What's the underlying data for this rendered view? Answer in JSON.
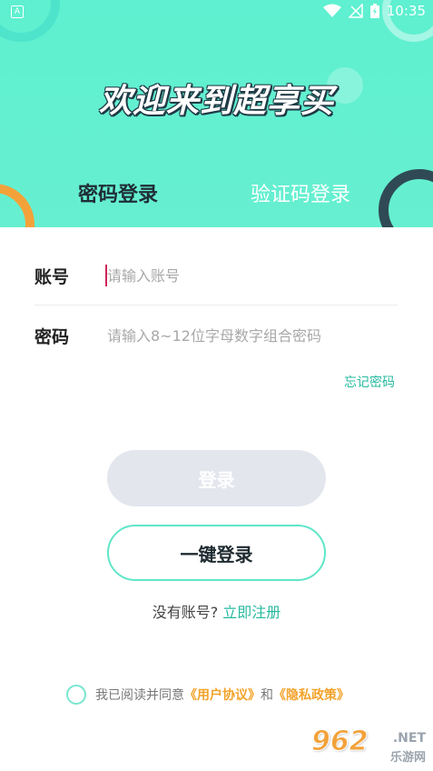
{
  "statusbar": {
    "time": "10:35",
    "left_icon": "A"
  },
  "header": {
    "title": "欢迎来到超享买",
    "tabs": [
      {
        "label": "密码登录",
        "active": true
      },
      {
        "label": "验证码登录",
        "active": false
      }
    ]
  },
  "form": {
    "account_label": "账号",
    "account_placeholder": "请输入账号",
    "password_label": "密码",
    "password_placeholder": "请输入8~12位字母数字组合密码",
    "forgot_label": "忘记密码"
  },
  "buttons": {
    "login_label": "登录",
    "quick_login_label": "一键登录"
  },
  "register": {
    "prompt": "没有账号?",
    "link_label": "立即注册"
  },
  "agreement": {
    "prefix": "我已阅读并同意",
    "user_agreement": "《用户协议》",
    "conjunction": "和",
    "privacy_policy": "《隐私政策》"
  },
  "watermark": {
    "number": "962",
    "domain": ".NET",
    "site_name": "乐游网"
  },
  "colors": {
    "header_bg": "#5ef0d0",
    "accent": "#27b99f",
    "orange": "#f2a32b",
    "dark": "#1f3a45"
  }
}
